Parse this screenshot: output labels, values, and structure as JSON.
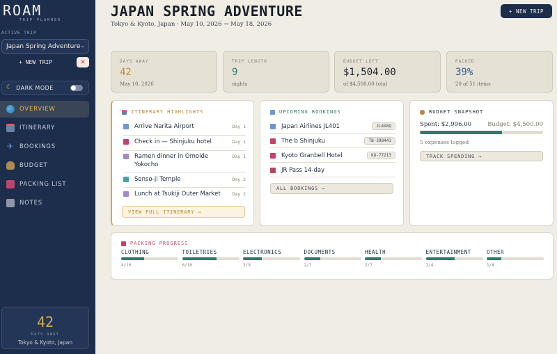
{
  "sidebar": {
    "brand": "ROAM",
    "brand_sub": "TRIP PLANNER",
    "active_trip_label": "ACTIVE TRIP",
    "active_trip": "Japan Spring Adventure",
    "new_trip": "+ NEW TRIP",
    "close": "✕",
    "dark_mode": "DARK MODE",
    "dark_mode_on": false,
    "nav": [
      {
        "label": "OVERVIEW",
        "icon": "globe-icon",
        "active": true
      },
      {
        "label": "ITINERARY",
        "icon": "calendar-icon"
      },
      {
        "label": "BOOKINGS",
        "icon": "plane-icon"
      },
      {
        "label": "BUDGET",
        "icon": "money-bag-icon"
      },
      {
        "label": "PACKING LIST",
        "icon": "backpack-icon"
      },
      {
        "label": "NOTES",
        "icon": "notes-icon"
      }
    ],
    "countdown": {
      "number": "42",
      "label": "DAYS AWAY",
      "location": "Tokyo & Kyoto, Japan"
    }
  },
  "header": {
    "title": "JAPAN SPRING ADVENTURE",
    "subtitle": "Tokyo & Kyoto, Japan · May 10, 2026 → May 18, 2026",
    "new_trip": "+ NEW TRIP"
  },
  "stats": [
    {
      "label": "DAYS AWAY",
      "value": "42",
      "note": "May 10, 2026",
      "color": "#c0913a"
    },
    {
      "label": "TRIP LENGTH",
      "value": "9",
      "note": "nights",
      "color": "#2f7a6a"
    },
    {
      "label": "BUDGET LEFT",
      "value": "$1,504.00",
      "note": "of $4,500.00 total",
      "color": "#1a1f2b"
    },
    {
      "label": "PACKED",
      "value": "39%",
      "note": "20 of 51 items",
      "color": "#2e5a9e"
    }
  ],
  "itinerary": {
    "title": "ITINERARY HIGHLIGHTS",
    "items": [
      {
        "text": "Arrive Narita Airport",
        "day": "Day 1",
        "icon": "plane-icon"
      },
      {
        "text": "Check in — Shinjuku hotel",
        "day": "Day 1",
        "icon": "hotel-icon"
      },
      {
        "text": "Ramen dinner in Omoide Yokocho",
        "day": "Day 1",
        "icon": "food-icon"
      },
      {
        "text": "Senso-ji Temple",
        "day": "Day 2",
        "icon": "temple-icon"
      },
      {
        "text": "Lunch at Tsukiji Outer Market",
        "day": "Day 2",
        "icon": "food-icon"
      }
    ],
    "button": "VIEW FULL ITINERARY →"
  },
  "bookings": {
    "title": "UPCOMING BOOKINGS",
    "items": [
      {
        "text": "Japan Airlines JL401",
        "code": "JL4X8Q",
        "icon": "plane-icon"
      },
      {
        "text": "The b Shinjuku",
        "code": "TB-298441",
        "icon": "hotel-icon"
      },
      {
        "text": "Kyoto Granbell Hotel",
        "code": "KG-77213",
        "icon": "hotel-icon"
      },
      {
        "text": "JR Pass 14-day",
        "code": "",
        "icon": "train-icon"
      }
    ],
    "button": "ALL BOOKINGS →"
  },
  "budget": {
    "title": "BUDGET SNAPSHOT",
    "spent": "Spent: $2,996.00",
    "total": "Budget: $4,500.00",
    "fraction": 0.666,
    "expenses": "5 expenses logged",
    "button": "TRACK SPENDING →"
  },
  "packing": {
    "title": "PACKING PROGRESS",
    "categories": [
      {
        "name": "CLOTHING",
        "count": "4/10",
        "fraction": 0.4
      },
      {
        "name": "TOILETRIES",
        "count": "6/10",
        "fraction": 0.6
      },
      {
        "name": "ELECTRONICS",
        "count": "3/9",
        "fraction": 0.333
      },
      {
        "name": "DOCUMENTS",
        "count": "2/7",
        "fraction": 0.286
      },
      {
        "name": "HEALTH",
        "count": "2/7",
        "fraction": 0.286
      },
      {
        "name": "ENTERTAINMENT",
        "count": "2/4",
        "fraction": 0.5
      },
      {
        "name": "OTHER",
        "count": "1/4",
        "fraction": 0.25
      }
    ]
  }
}
